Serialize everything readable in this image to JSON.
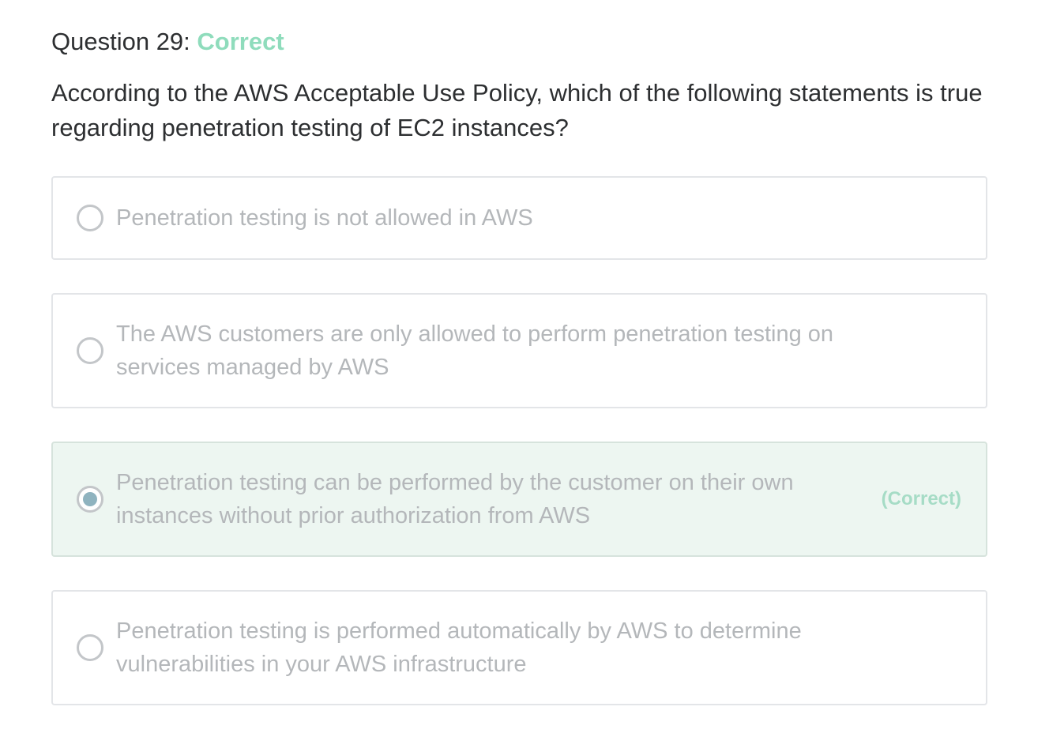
{
  "question": {
    "label": "Question 29:",
    "status": "Correct",
    "text": "According to the AWS Acceptable Use Policy, which of the following statements is true regarding penetration testing of EC2 instances?"
  },
  "options": [
    {
      "text": "Penetration testing is not allowed in AWS",
      "selected": false
    },
    {
      "text": "The AWS customers are only allowed to perform penetration testing on services managed by AWS",
      "selected": false
    },
    {
      "text": "Penetration testing can be performed by the customer on their own instances without prior authorization from AWS",
      "selected": true,
      "tag": "(Correct)"
    },
    {
      "text": "Penetration testing is performed automatically by AWS to determine vulnerabilities in your AWS infrastructure",
      "selected": false
    }
  ],
  "colors": {
    "correct_text": "#8fdcbc",
    "correct_bg": "#edf6f1",
    "selected_dot": "#8fb3bf",
    "option_text": "#b4b7ba"
  }
}
